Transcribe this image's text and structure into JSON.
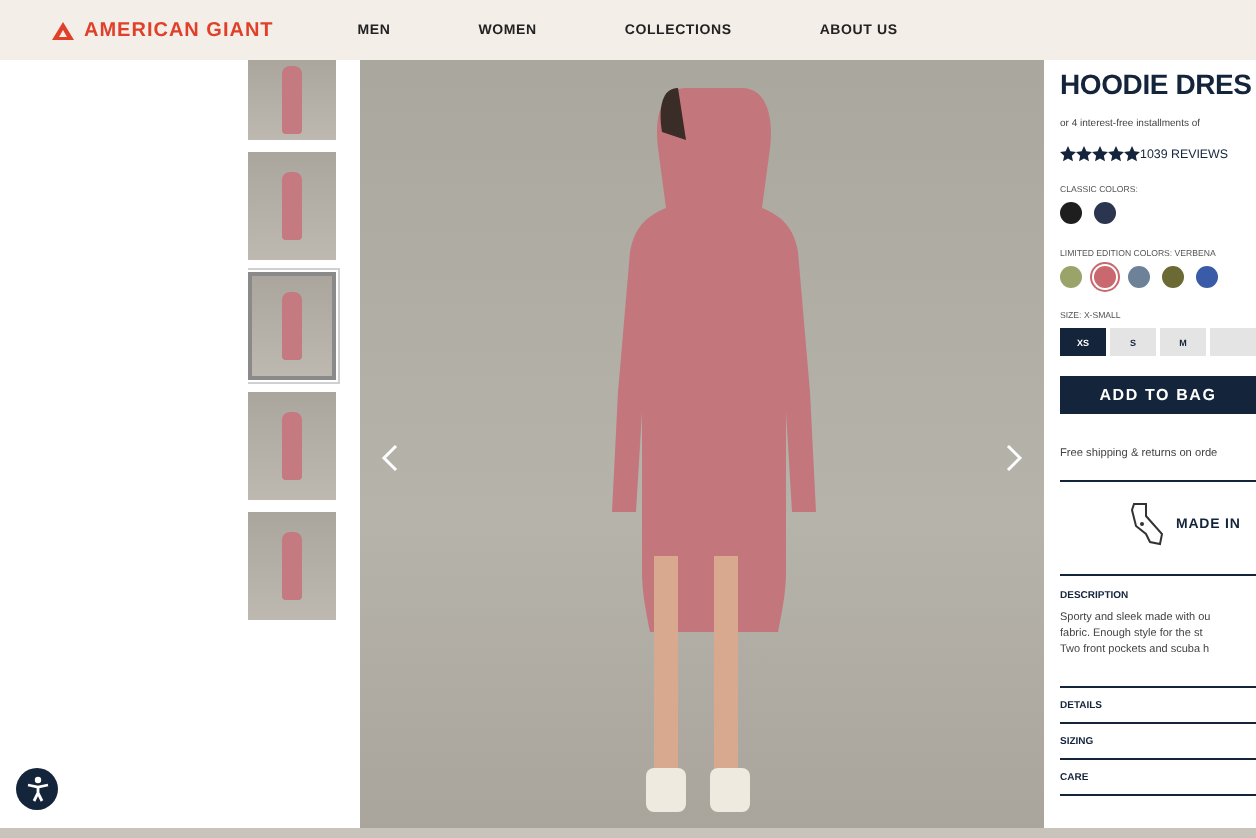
{
  "header": {
    "brand": "AMERICAN GIANT",
    "nav": [
      {
        "label": "MEN"
      },
      {
        "label": "WOMEN"
      },
      {
        "label": "COLLECTIONS"
      },
      {
        "label": "ABOUT US"
      }
    ]
  },
  "gallery": {
    "thumbnails": [
      {
        "selected": false
      },
      {
        "selected": false
      },
      {
        "selected": true
      },
      {
        "selected": false
      },
      {
        "selected": false
      }
    ]
  },
  "product": {
    "title": "HOODIE DRES",
    "installments": "or 4 interest-free installments of",
    "stars": 5,
    "reviews": "1039 REVIEWS",
    "classic_label": "CLASSIC COLORS:",
    "classic_colors": [
      {
        "color": "#1e1e1e",
        "selected": false
      },
      {
        "color": "#2c3550",
        "selected": false
      }
    ],
    "limited_label": "LIMITED EDITION COLORS: VERBENA",
    "limited_colors": [
      {
        "color": "#9aa46a",
        "selected": false
      },
      {
        "color": "#c9686e",
        "selected": true
      },
      {
        "color": "#6d8199",
        "selected": false
      },
      {
        "color": "#6b6a35",
        "selected": false
      },
      {
        "color": "#3a5ca8",
        "selected": false
      }
    ],
    "size_label": "SIZE: X-SMALL",
    "sizes": [
      {
        "label": "XS",
        "selected": true
      },
      {
        "label": "S",
        "selected": false
      },
      {
        "label": "M",
        "selected": false
      },
      {
        "selected": false
      }
    ],
    "add_button": "ADD TO BAG",
    "shipping": "Free shipping & returns on orde",
    "made_in": "MADE IN",
    "sections": [
      {
        "title": "DESCRIPTION",
        "expanded": true,
        "lines": [
          "Sporty and sleek made with ou",
          "fabric. Enough style for the st",
          "Two front pockets and scuba h"
        ]
      },
      {
        "title": "DETAILS",
        "expanded": false
      },
      {
        "title": "SIZING",
        "expanded": false
      },
      {
        "title": "CARE",
        "expanded": false
      }
    ]
  }
}
